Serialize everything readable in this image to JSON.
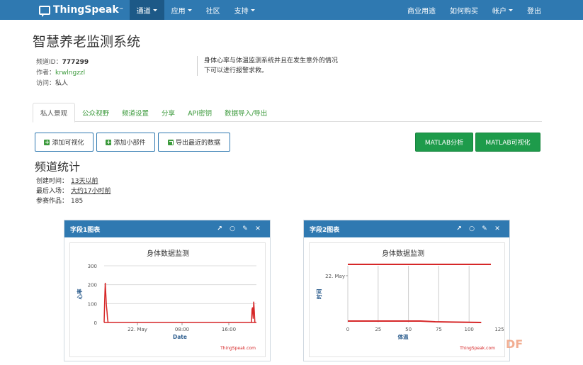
{
  "nav": {
    "brand": "ThingSpeak",
    "brand_tm": "™",
    "left": [
      {
        "label": "通道",
        "dropdown": true,
        "active": true
      },
      {
        "label": "应用",
        "dropdown": true,
        "active": false
      },
      {
        "label": "社区",
        "dropdown": false,
        "active": false
      },
      {
        "label": "支持",
        "dropdown": true,
        "active": false
      }
    ],
    "right": [
      {
        "label": "商业用途",
        "dropdown": false
      },
      {
        "label": "如何购买",
        "dropdown": false
      },
      {
        "label": "帐户",
        "dropdown": true
      },
      {
        "label": "登出",
        "dropdown": false
      }
    ]
  },
  "page": {
    "title": "智慧养老监测系统",
    "channel_id_label": "频道ID：",
    "channel_id": "777299",
    "author_label": "作者：",
    "author": "krwlngzzl",
    "access_label": "访问：",
    "access": "私人",
    "description_line1": "身体心率与体温监测系统并且在发生意外的情况",
    "description_line2": "下可以进行报警求救。"
  },
  "tabs": [
    "私人景观",
    "公众视野",
    "频道设置",
    "分享",
    "API密钥",
    "数据导入/导出"
  ],
  "buttons": {
    "add_visualization": "添加可视化",
    "add_widget": "添加小部件",
    "export_recent": "导出最近的数据",
    "matlab_analysis": "MATLAB分析",
    "matlab_visualization": "MATLAB可视化"
  },
  "stats": {
    "title": "频道统计",
    "created_label": "创建时间：",
    "created": "13天以前",
    "last_entry_label": "最后入场：",
    "last_entry": "大约17小时前",
    "entries_label": "参赛作品：",
    "entries": "185"
  },
  "colors": {
    "navbar": "#2f79b1",
    "accent_green": "#1e9b4b",
    "series": "#d62728"
  },
  "chart_data": [
    {
      "type": "line",
      "panel_title": "字段1图表",
      "title": "身体数据监测",
      "xlabel": "Date",
      "ylabel": "心率",
      "ylim": [
        0,
        300
      ],
      "yticks": [
        0,
        100,
        200,
        300
      ],
      "xticks": [
        "22. May",
        "08:00",
        "16:00"
      ],
      "credit": "ThingSpeak.com",
      "series": [
        {
          "values_start": [
            0,
            120,
            210,
            150,
            90,
            60,
            20,
            0
          ],
          "values_end": [
            0,
            70,
            80,
            20,
            110,
            60,
            0
          ]
        }
      ]
    },
    {
      "type": "scatter",
      "panel_title": "字段2图表",
      "title": "身体数据监测",
      "xlabel": "体温",
      "ylabel": "时间",
      "xlim": [
        0,
        125
      ],
      "xticks": [
        0,
        25,
        50,
        75,
        100,
        125
      ],
      "yticks": [
        "22. May"
      ],
      "credit": "ThingSpeak.com"
    }
  ]
}
